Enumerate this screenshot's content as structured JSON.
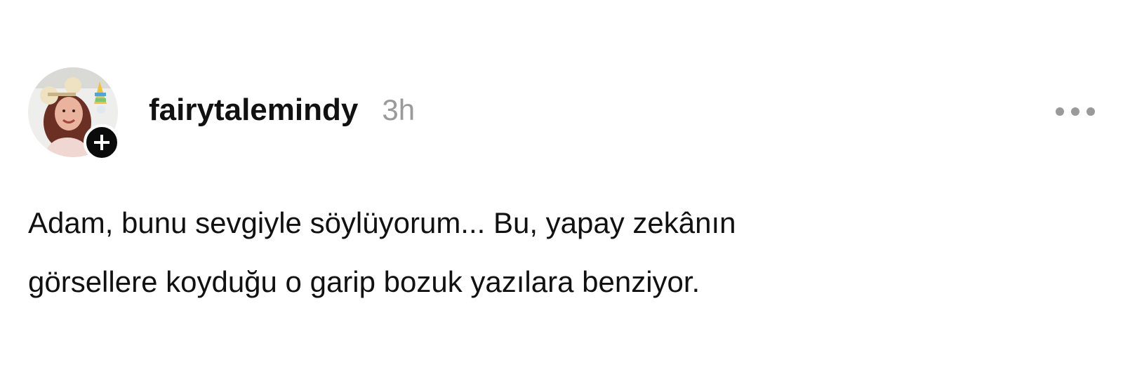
{
  "post": {
    "author": {
      "username": "fairytalemindy",
      "avatar_icon": "profile-photo",
      "follow_icon": "plus-icon"
    },
    "timestamp": "3h",
    "menu_icon": "more-horizontal-icon",
    "text_lines": [
      "Adam, bunu sevgiyle söylüyorum... Bu, yapay zekânın",
      "görsellere koyduğu o garip bozuk yazılara benziyor."
    ]
  },
  "colors": {
    "background": "#ffffff",
    "text": "#111111",
    "muted": "#9a9a9a",
    "badge": "#0b0b0b"
  }
}
